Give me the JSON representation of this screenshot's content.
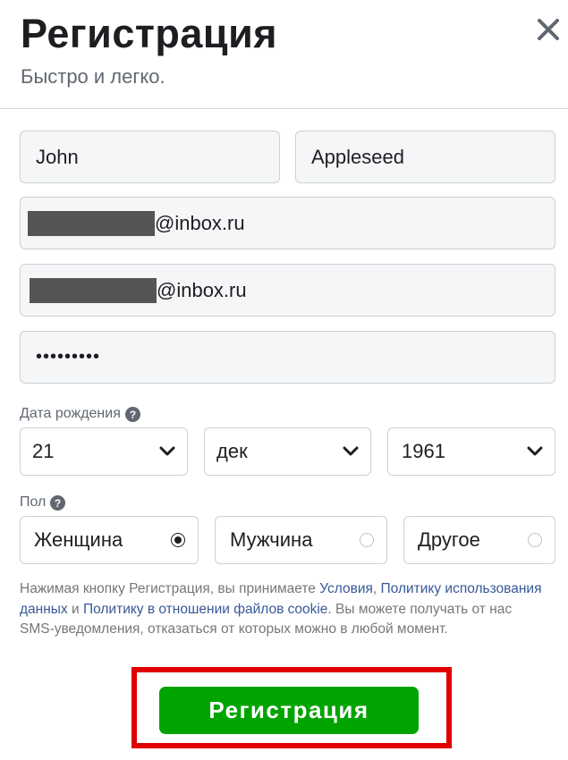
{
  "header": {
    "title": "Регистрация",
    "subtitle": "Быстро и легко."
  },
  "form": {
    "first_name": "John",
    "last_name": "Appleseed",
    "email_domain": "@inbox.ru",
    "email_confirm_domain": "@inbox.ru",
    "password_masked": "•••••••••"
  },
  "birthday": {
    "label": "Дата рождения",
    "day": "21",
    "month": "дек",
    "year": "1961"
  },
  "gender": {
    "label": "Пол",
    "options": [
      {
        "label": "Женщина",
        "checked": true
      },
      {
        "label": "Мужчина",
        "checked": false
      },
      {
        "label": "Другое",
        "checked": false
      }
    ]
  },
  "terms": {
    "part1": "Нажимая кнопку Регистрация, вы принимаете ",
    "link_terms": "Условия",
    "sep": ", ",
    "link_data": "Политику использования данных",
    "and": " и ",
    "link_cookie": "Политику в отношении файлов cookie",
    "part2": ". Вы можете получать от нас SMS-уведомления, отказаться от которых можно в любой момент."
  },
  "submit_label": "Регистрация",
  "colors": {
    "submit": "#00a400",
    "highlight": "#e00000",
    "link": "#385898"
  }
}
